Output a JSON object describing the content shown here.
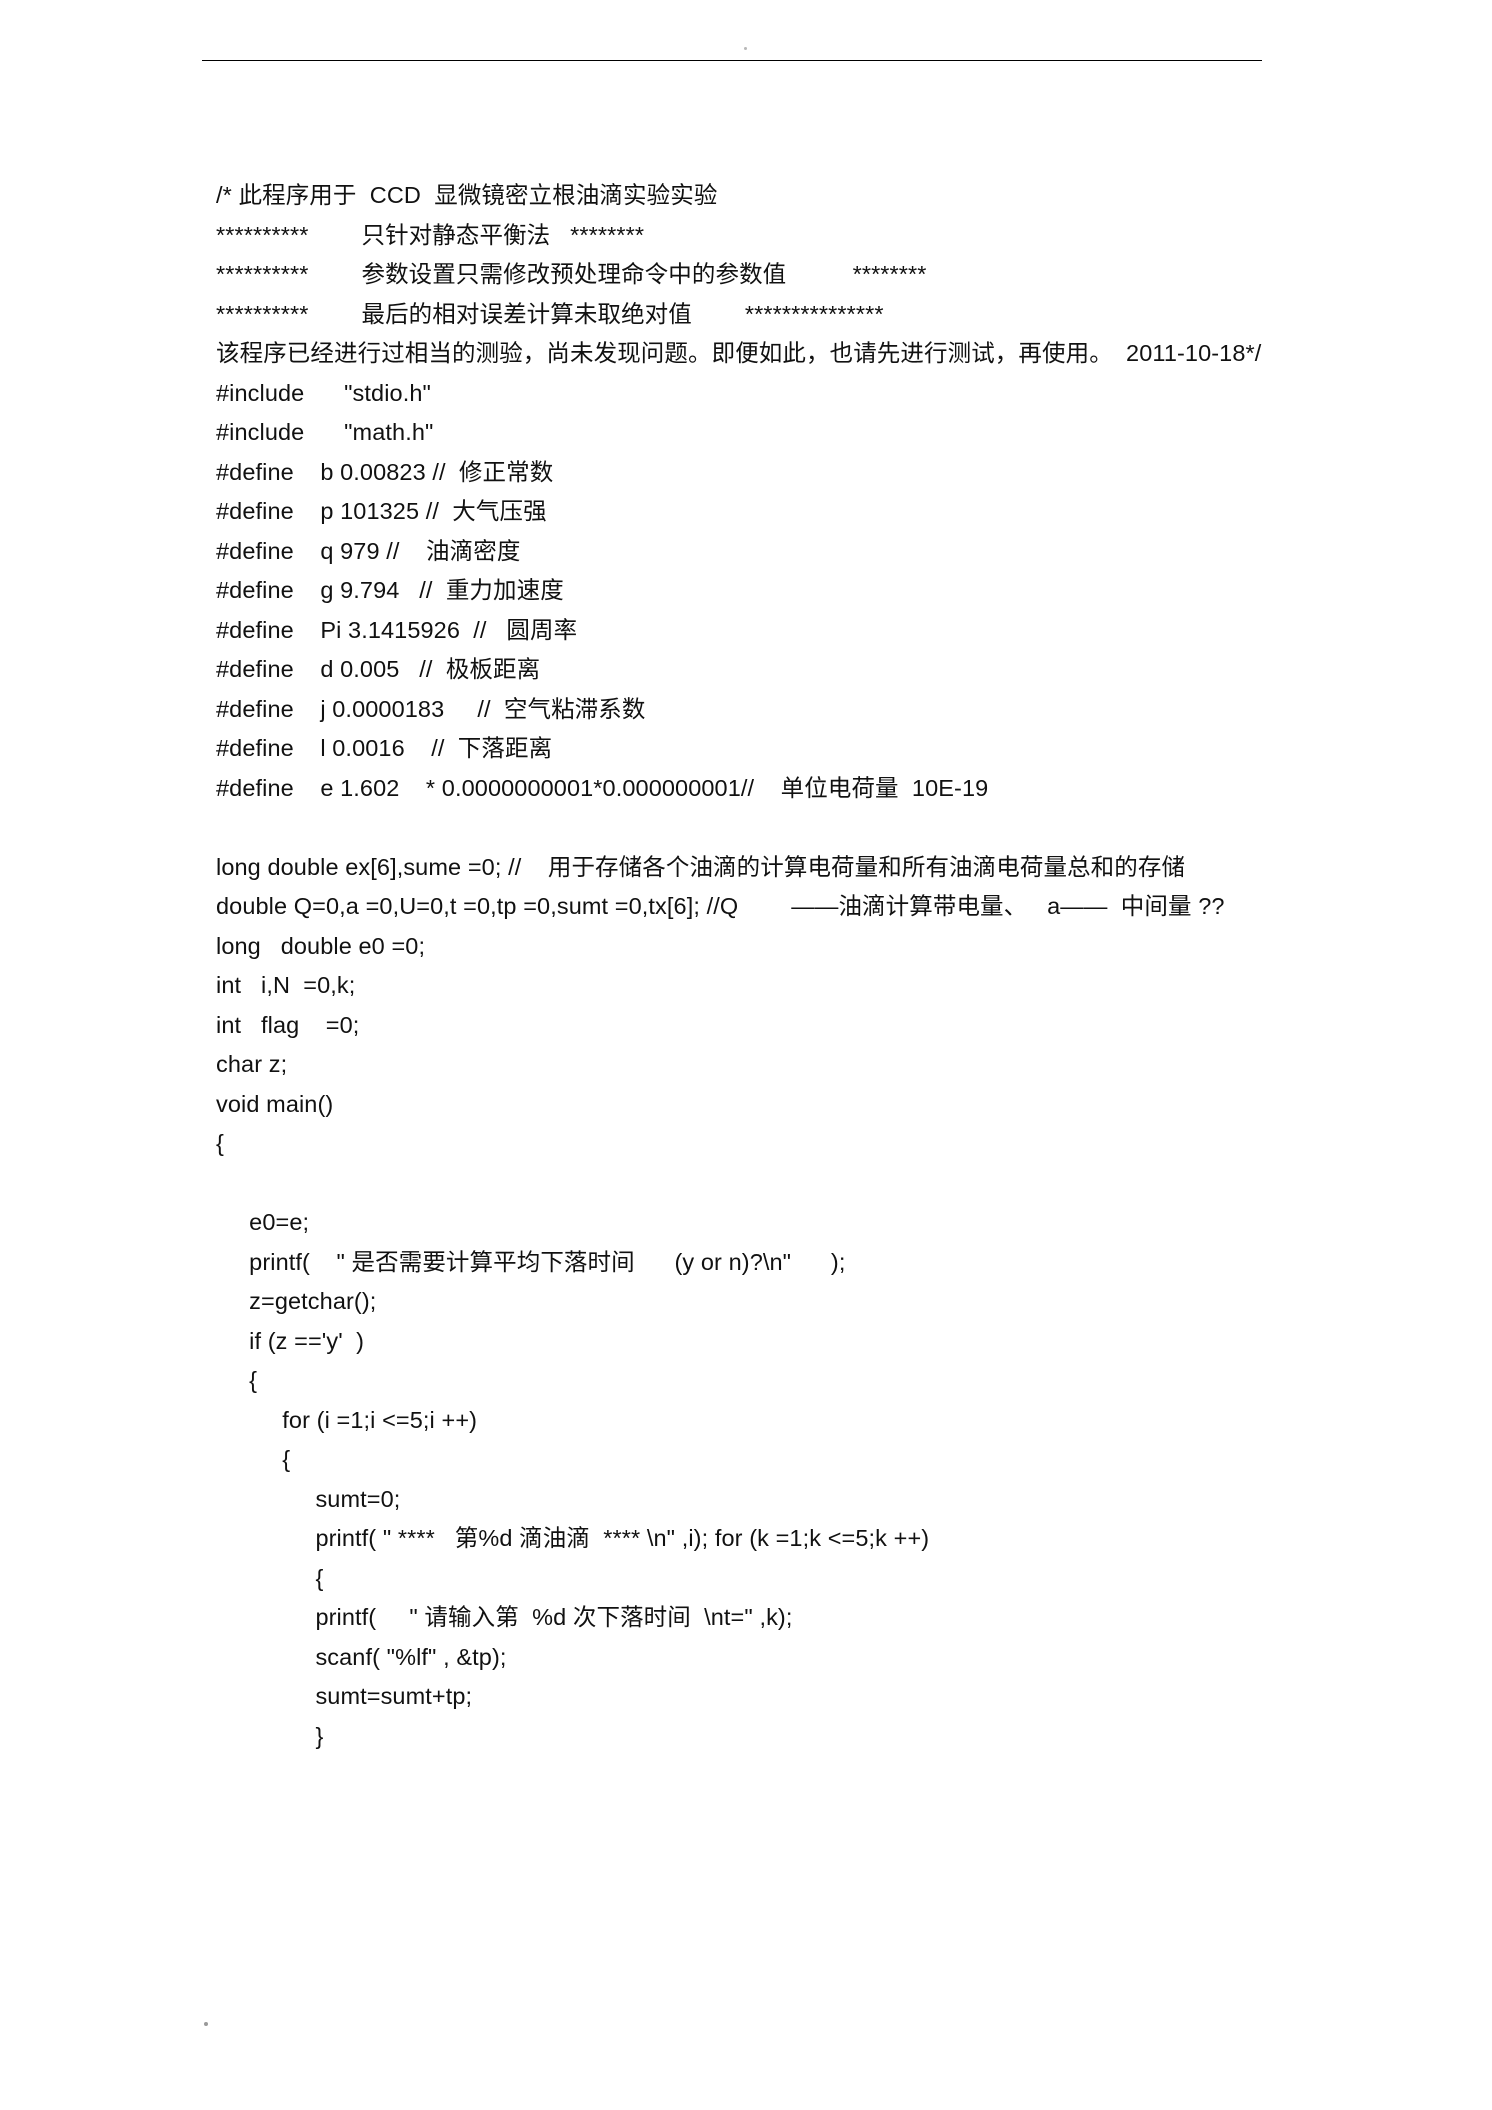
{
  "document": {
    "type": "code-listing",
    "language": "C",
    "page_background": "#ffffff",
    "text_color": "#111111",
    "header_rule": true
  },
  "lines": [
    {
      "id": "l01",
      "text": "/* 此程序用于  CCD  显微镜密立根油滴实验实验"
    },
    {
      "id": "l02",
      "text": "**********        只针对静态平衡法   ********"
    },
    {
      "id": "l03",
      "text": "**********        参数设置只需修改预处理命令中的参数值          ********"
    },
    {
      "id": "l04",
      "text": "**********        最后的相对误差计算未取绝对值        ***************"
    },
    {
      "id": "l05",
      "text": "该程序已经进行过相当的测验，尚未发现问题。即便如此，也请先进行测试，再使用。  2011-10-18*/"
    },
    {
      "id": "l06",
      "text": "#include      \"stdio.h\""
    },
    {
      "id": "l07",
      "text": "#include      \"math.h\""
    },
    {
      "id": "l08",
      "text": "#define    b 0.00823 //  修正常数"
    },
    {
      "id": "l09",
      "text": "#define    p 101325 //  大气压强"
    },
    {
      "id": "l10",
      "text": "#define    q 979 //    油滴密度"
    },
    {
      "id": "l11",
      "text": "#define    g 9.794   //  重力加速度"
    },
    {
      "id": "l12",
      "text": "#define    Pi 3.1415926  //   圆周率"
    },
    {
      "id": "l13",
      "text": "#define    d 0.005   //  极板距离"
    },
    {
      "id": "l14",
      "text": "#define    j 0.0000183     //  空气粘滞系数"
    },
    {
      "id": "l15",
      "text": "#define    l 0.0016    //  下落距离"
    },
    {
      "id": "l16",
      "text": "#define    e 1.602    * 0.0000000001*0.000000001//    单位电荷量  10E-19"
    },
    {
      "id": "l17",
      "text": ""
    },
    {
      "id": "l18",
      "text": "long double ex[6],sume =0; //    用于存储各个油滴的计算电荷量和所有油滴电荷量总和的存储"
    },
    {
      "id": "l19",
      "text": "double Q=0,a =0,U=0,t =0,tp =0,sumt =0,tx[6]; //Q        ——油滴计算带电量、   a——  中间量 ??"
    },
    {
      "id": "l20",
      "text": "long   double e0 =0;"
    },
    {
      "id": "l21",
      "text": "int   i,N  =0,k;"
    },
    {
      "id": "l22",
      "text": "int   flag    =0;"
    },
    {
      "id": "l23",
      "text": "char z;"
    },
    {
      "id": "l24",
      "text": "void main()"
    },
    {
      "id": "l25",
      "text": "{"
    },
    {
      "id": "l26",
      "text": ""
    },
    {
      "id": "l27",
      "text": "     e0=e;"
    },
    {
      "id": "l28",
      "text": "     printf(    \" 是否需要计算平均下落时间      (y or n)?\\n\"      );"
    },
    {
      "id": "l29",
      "text": "     z=getchar();"
    },
    {
      "id": "l30",
      "text": "     if (z =='y'  )"
    },
    {
      "id": "l31",
      "text": "     {"
    },
    {
      "id": "l32",
      "text": "          for (i =1;i <=5;i ++)"
    },
    {
      "id": "l33",
      "text": "          {"
    },
    {
      "id": "l34",
      "text": "               sumt=0;"
    },
    {
      "id": "l35",
      "text": "               printf( \" ****   第%d 滴油滴  **** \\n\" ,i); for (k =1;k <=5;k ++)"
    },
    {
      "id": "l36",
      "text": "               {"
    },
    {
      "id": "l37",
      "text": "               printf(     \" 请输入第  %d 次下落时间  \\nt=\" ,k);"
    },
    {
      "id": "l38",
      "text": "               scanf( \"%lf\" , &tp);"
    },
    {
      "id": "l39",
      "text": "               sumt=sumt+tp;"
    },
    {
      "id": "l40",
      "text": "               }"
    }
  ]
}
